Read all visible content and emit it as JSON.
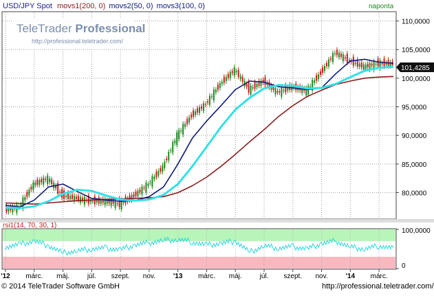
{
  "header": {
    "symbol": "USD/JPY Spot",
    "mov1": "movs1(200, 0)",
    "mov2": "movs2(50, 0)",
    "mov3": "movs3(100, 0)",
    "interval": "naponta"
  },
  "watermark": {
    "brand_light": "TeleTrader",
    "brand_bold": "Professional",
    "url": "http://professional.teletrader.com/"
  },
  "footer": {
    "copyright": "© 2014 TeleTrader Software GmbH",
    "url": "http://professional.teletrader.com/"
  },
  "colors": {
    "price_up": "#1a8a1a",
    "price_down": "#cc1a1a",
    "movs1": "#8b1a1a",
    "movs2": "#0d1a7a",
    "movs3": "#33e0e8",
    "rsi_line": "#2ad6e0",
    "rsi_overbought_zone": "#b8f5b8",
    "rsi_oversold_zone": "#f8b8c0",
    "last_price_label_bg": "#111111"
  },
  "chart_data": [
    {
      "type": "line",
      "title": "USD/JPY Spot",
      "ylim": [
        75500,
        111500
      ],
      "yticks": [
        "80000",
        "85000",
        "90000",
        "95000",
        "100000",
        "105000",
        "110000"
      ],
      "ytick_labels": [
        "80,0000",
        "85,0000",
        "90,0000",
        "95,0000",
        "100,0000",
        "105,0000",
        "110,0000"
      ],
      "last_value_label": "101,4285",
      "xticks": [
        "'12",
        "márc.",
        "máj.",
        "júl.",
        "szept.",
        "nov.",
        "'13",
        "márc.",
        "máj.",
        "júl.",
        "szept.",
        "nov.",
        "'14",
        "márc."
      ],
      "x": [
        "2012-01",
        "2012-02",
        "2012-03",
        "2012-04",
        "2012-05",
        "2012-06",
        "2012-07",
        "2012-08",
        "2012-09",
        "2012-10",
        "2012-11",
        "2012-12",
        "2013-01",
        "2013-02",
        "2013-03",
        "2013-04",
        "2013-05",
        "2013-06",
        "2013-07",
        "2013-08",
        "2013-09",
        "2013-10",
        "2013-11",
        "2013-12",
        "2014-01",
        "2014-02",
        "2014-03",
        "2014-04"
      ],
      "series": [
        {
          "name": "USD/JPY Spot",
          "values": [
            77000,
            77500,
            81500,
            82500,
            79500,
            79000,
            78500,
            78500,
            78000,
            79500,
            81500,
            84500,
            90000,
            93500,
            95500,
            99000,
            101500,
            98000,
            99500,
            97500,
            98500,
            97800,
            101000,
            104500,
            103000,
            102000,
            102600,
            102500
          ]
        },
        {
          "name": "movs1(200, 0)",
          "values": [
            78200,
            78100,
            78000,
            78200,
            78400,
            78600,
            78700,
            78800,
            78900,
            79000,
            79100,
            79300,
            80000,
            81200,
            82700,
            84600,
            86700,
            88900,
            91000,
            93300,
            95200,
            96800,
            97900,
            98900,
            99500,
            100000,
            100200,
            100300
          ]
        },
        {
          "name": "movs2(50, 0)",
          "values": [
            77800,
            77500,
            78700,
            81000,
            81500,
            80200,
            79000,
            78700,
            78500,
            78600,
            79300,
            81000,
            85000,
            89500,
            92500,
            95200,
            98000,
            99500,
            99300,
            98500,
            98300,
            98000,
            98300,
            100800,
            103000,
            103300,
            102800,
            102600
          ]
        },
        {
          "name": "movs3(100, 0)",
          "values": [
            77400,
            77300,
            77600,
            78500,
            79800,
            80500,
            80300,
            79500,
            78800,
            78600,
            78800,
            79600,
            81500,
            84600,
            88000,
            91500,
            94500,
            96600,
            98200,
            98800,
            98700,
            98200,
            98300,
            99000,
            100200,
            101300,
            101800,
            102000
          ]
        }
      ]
    },
    {
      "type": "line",
      "title": "rsi1(14, 70, 30, 1)",
      "ylim": [
        0,
        100
      ],
      "yticks": [
        "0",
        "100"
      ],
      "ytick_labels": [
        "0",
        "100,0000"
      ],
      "overbought": 70,
      "oversold": 30,
      "series": [
        {
          "name": "rsi1(14, 70, 30, 1)",
          "values": [
            55,
            62,
            70,
            58,
            40,
            45,
            50,
            52,
            48,
            60,
            66,
            72,
            74,
            68,
            60,
            64,
            70,
            42,
            58,
            52,
            56,
            50,
            64,
            70,
            55,
            50,
            58,
            52
          ]
        }
      ]
    }
  ]
}
